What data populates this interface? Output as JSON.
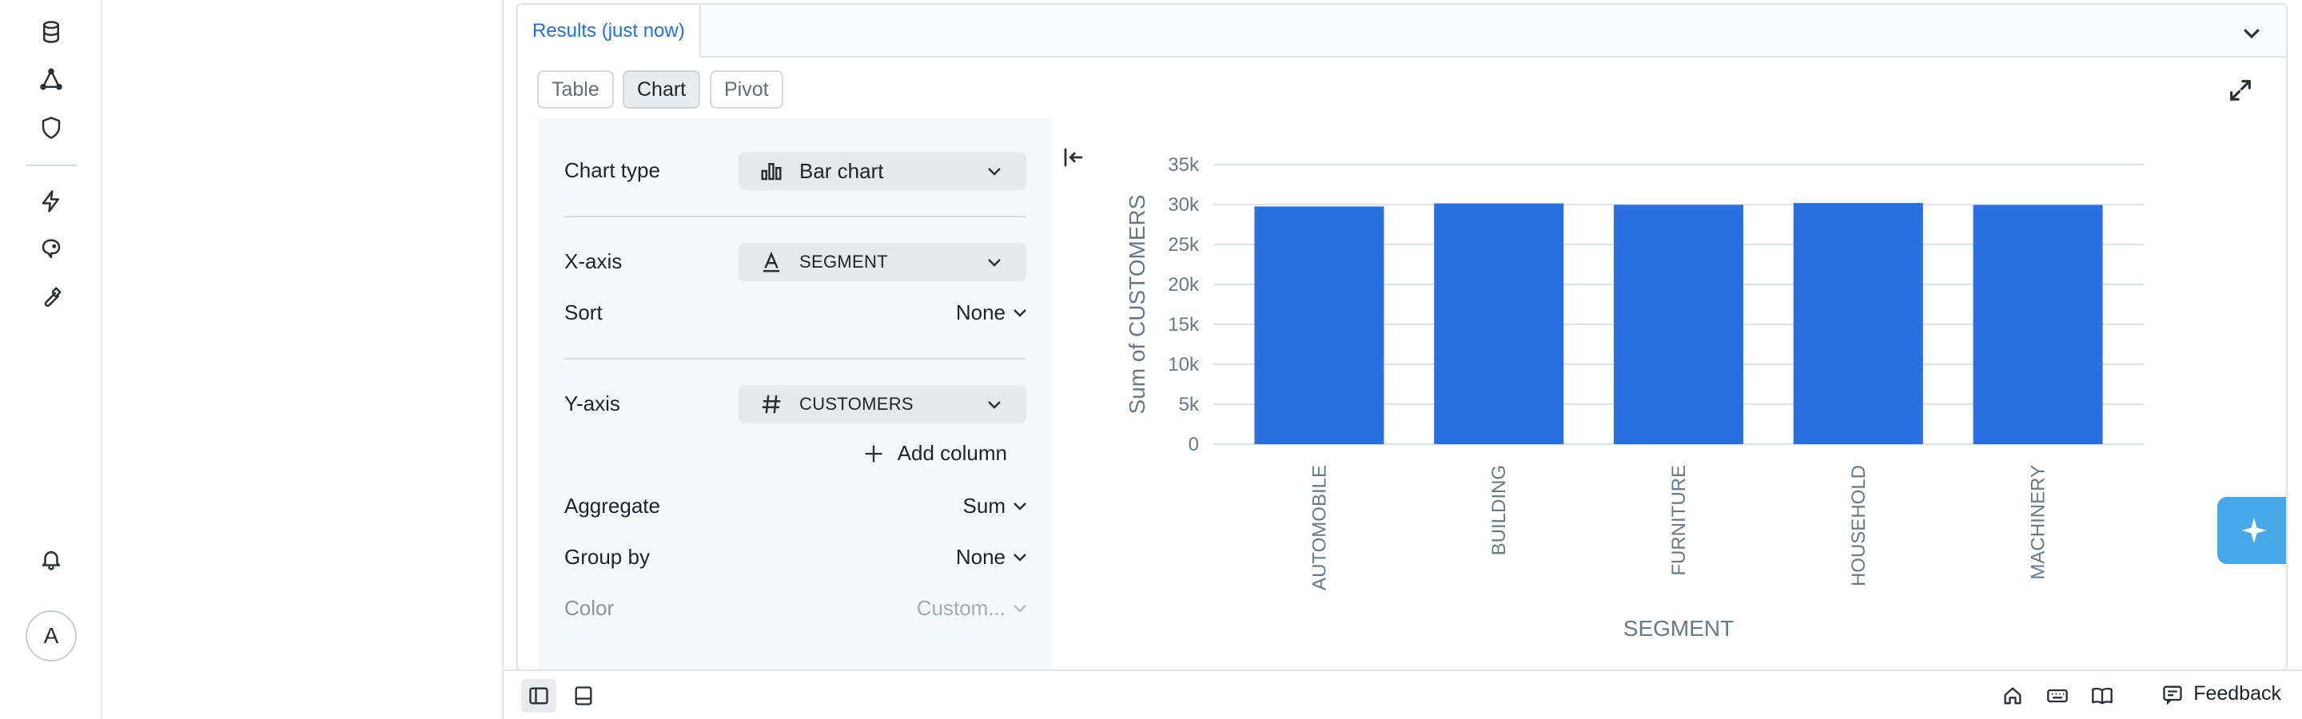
{
  "results": {
    "tab_label": "Results (just now)",
    "views": [
      "Table",
      "Chart",
      "Pivot"
    ],
    "active_view": "Chart"
  },
  "config": {
    "chart_type_label": "Chart type",
    "chart_type_value": "Bar chart",
    "x_axis_label": "X-axis",
    "x_axis_value": "SEGMENT",
    "sort_label": "Sort",
    "sort_value": "None",
    "y_axis_label": "Y-axis",
    "y_axis_value": "CUSTOMERS",
    "add_column_label": "Add column",
    "aggregate_label": "Aggregate",
    "aggregate_value": "Sum",
    "group_by_label": "Group by",
    "group_by_value": "None",
    "color_label": "Color",
    "color_value": "Custom..."
  },
  "chart_data": {
    "type": "bar",
    "categories": [
      "AUTOMOBILE",
      "BUILDING",
      "FURNITURE",
      "HOUSEHOLD",
      "MACHINERY"
    ],
    "values": [
      29752,
      30142,
      29968,
      30189,
      29949
    ],
    "yticks": [
      "0",
      "5k",
      "10k",
      "15k",
      "20k",
      "25k",
      "30k",
      "35k"
    ],
    "ylim": [
      0,
      35000
    ],
    "xlabel": "SEGMENT",
    "ylabel": "Sum of CUSTOMERS",
    "grid": true,
    "bar_color": "#2a6fdf"
  },
  "statusbar": {
    "feedback_label": "Feedback"
  },
  "user": {
    "avatar_initial": "A"
  }
}
